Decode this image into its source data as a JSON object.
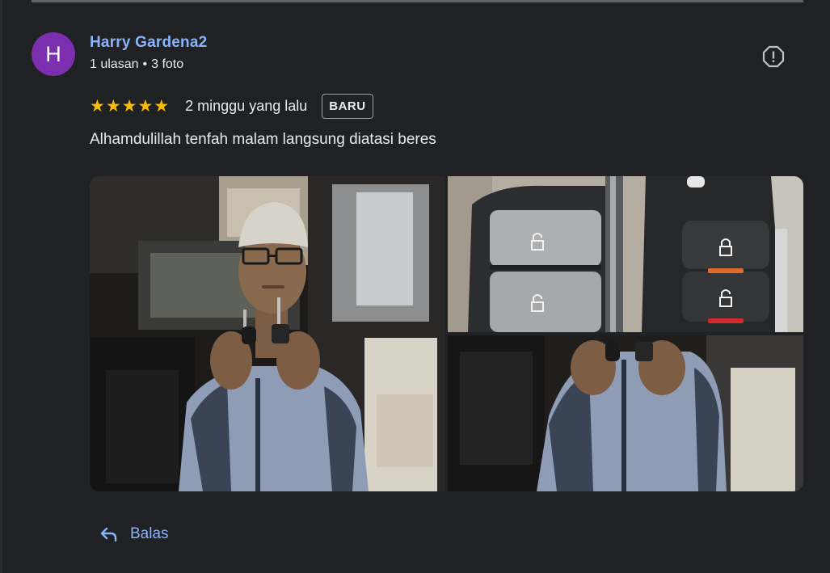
{
  "review": {
    "author": {
      "initial": "H",
      "name": "Harry Gardena2",
      "reviews_count": "1 ulasan",
      "separator": "•",
      "photos_count": "3 foto"
    },
    "rating": 5,
    "time": "2 minggu yang lalu",
    "badge": "BARU",
    "text": "Alhamdulillah tenfah malam langsung diatasi beres",
    "photos": [
      {
        "name": "photo-technician-holding-keys"
      },
      {
        "name": "photo-key-fob-closeup"
      },
      {
        "name": "photo-technician-holding-keys-2"
      }
    ],
    "actions": {
      "reply_label": "Balas",
      "report_icon": "report-icon"
    }
  },
  "colors": {
    "background": "#202124",
    "link": "#8ab4f8",
    "star": "#fbbc04",
    "avatar": "#7b2fae"
  }
}
